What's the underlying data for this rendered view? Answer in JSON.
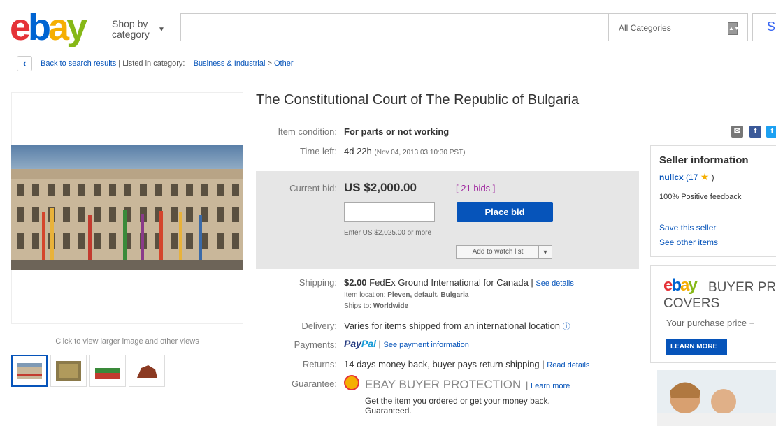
{
  "header": {
    "logo": {
      "e": "e",
      "b": "b",
      "a": "a",
      "y": "y"
    },
    "shop_by": "Shop by",
    "shop_by_2": "category",
    "search_placeholder": "",
    "category": "All Categories",
    "search_button": "S"
  },
  "breadcrumb": {
    "back": "Back to search results",
    "listed": "| Listed in category:",
    "cat1": "Business & Industrial",
    "sep": ">",
    "cat2": "Other"
  },
  "gallery": {
    "click_text": "Click to view larger image and other views"
  },
  "item": {
    "title": "The Constitutional Court of The Republic of Bulgaria",
    "condition_label": "Item condition:",
    "condition": "For parts or not working",
    "time_label": "Time left:",
    "time_left": "4d 22h",
    "time_detail": "(Nov 04, 2013  03:10:30 PST)",
    "bid_label": "Current bid:",
    "price": "US $2,000.00",
    "bids_open": "[",
    "bids": "21 bids",
    "bids_close": "]",
    "place_bid": "Place bid",
    "enter_text": "Enter US $2,025.00 or more",
    "watch": "Add to watch list",
    "shipping_label": "Shipping:",
    "shipping_price": "$2.00",
    "shipping_text": "FedEx Ground International for Canada |",
    "see_details": "See details",
    "location_label": "Item location:",
    "location": "Pleven, default, Bulgaria",
    "ships_label": "Ships to:",
    "ships": "Worldwide",
    "delivery_label": "Delivery:",
    "delivery": "Varies for items shipped from an international location",
    "payments_label": "Payments:",
    "paypal_1": "Pay",
    "paypal_2": "Pal",
    "payment_link": "See payment information",
    "returns_label": "Returns:",
    "returns": "14 days money back, buyer pays return shipping |",
    "read_details": "Read details",
    "guarantee_label": "Guarantee:",
    "protection": "EBAY BUYER PROTECTION",
    "learn_more": "Learn more",
    "guarantee_text_1": "Get the item you ordered or get your money back.",
    "guarantee_text_2": "Guaranteed."
  },
  "seller": {
    "heading": "Seller information",
    "name": "nullcx",
    "score": "(17",
    "close": ")",
    "feedback": "100% Positive feedback",
    "save": "Save this seller",
    "other": "See other items"
  },
  "ad": {
    "logo_e": "e",
    "logo_b": "b",
    "logo_a": "a",
    "logo_y": "y",
    "line1": "BUYER PR",
    "line2": "COVERS",
    "line3": "Your purchase price +",
    "button": "LEARN MORE"
  },
  "colors": {
    "brand_blue": "#0654ba",
    "bid_bg": "#e6e6e6"
  }
}
